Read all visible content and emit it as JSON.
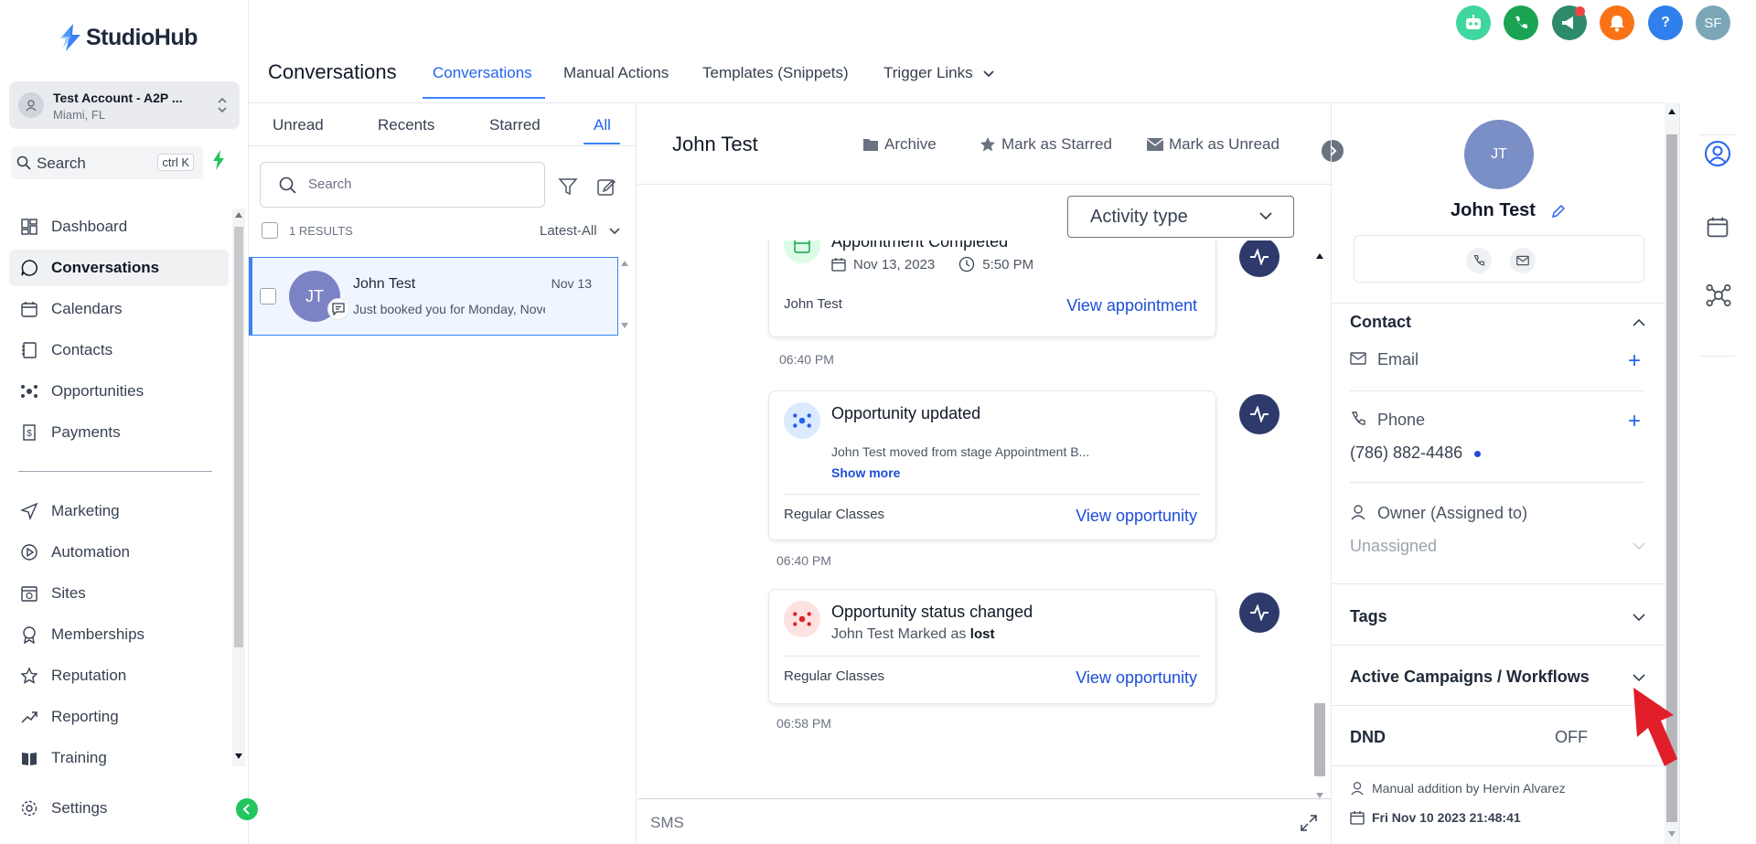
{
  "brand": {
    "name": "StudioHub",
    "accent": "#3b82f6"
  },
  "account": {
    "name": "Test Account - A2P ...",
    "location": "Miami, FL"
  },
  "sidebar": {
    "search_label": "Search",
    "shortcut": "ctrl K",
    "items": [
      {
        "label": "Dashboard",
        "icon": "dashboard-icon"
      },
      {
        "label": "Conversations",
        "icon": "chat-icon",
        "active": true
      },
      {
        "label": "Calendars",
        "icon": "calendar-icon"
      },
      {
        "label": "Contacts",
        "icon": "contacts-icon"
      },
      {
        "label": "Opportunities",
        "icon": "opportunities-icon"
      },
      {
        "label": "Payments",
        "icon": "payments-icon"
      },
      {
        "label": "Marketing",
        "icon": "send-icon"
      },
      {
        "label": "Automation",
        "icon": "automation-icon"
      },
      {
        "label": "Sites",
        "icon": "sites-icon"
      },
      {
        "label": "Memberships",
        "icon": "badge-icon"
      },
      {
        "label": "Reputation",
        "icon": "star-icon"
      },
      {
        "label": "Reporting",
        "icon": "trend-icon"
      },
      {
        "label": "Training",
        "icon": "book-icon"
      }
    ],
    "settings_label": "Settings"
  },
  "header": {
    "title": "Conversations",
    "tabs": [
      "Conversations",
      "Manual Actions",
      "Templates (Snippets)",
      "Trigger Links"
    ],
    "avatar_initials": "SF",
    "help_label": "?"
  },
  "list": {
    "tabs": [
      "Unread",
      "Recents",
      "Starred",
      "All"
    ],
    "search_placeholder": "Search",
    "results": "1 RESULTS",
    "sort": "Latest-All",
    "items": [
      {
        "initials": "JT",
        "name": "John Test",
        "date": "Nov 13",
        "snippet": "Just booked you for Monday, Nove"
      }
    ]
  },
  "thread": {
    "name": "John Test",
    "actions": [
      "Archive",
      "Mark as Starred",
      "Mark as Unread"
    ],
    "activity_type": "Activity type",
    "cards": [
      {
        "title": "Appointment Completed",
        "date": "Nov 13, 2023",
        "time": "5:50 PM",
        "foot_left": "John Test",
        "foot_right": "View appointment"
      },
      {
        "title": "Opportunity updated",
        "desc": "John Test moved from stage Appointment B...",
        "show_more": "Show more",
        "foot_left": "Regular Classes",
        "foot_right": "View opportunity"
      },
      {
        "title": "Opportunity status changed",
        "desc_prefix": "John Test Marked as ",
        "desc_bold": "lost",
        "foot_left": "Regular Classes",
        "foot_right": "View opportunity"
      }
    ],
    "timestamps": [
      "06:40 PM",
      "06:40 PM",
      "06:58 PM"
    ],
    "compose_label": "SMS"
  },
  "panel": {
    "initials": "JT",
    "name": "John Test",
    "contact_head": "Contact",
    "email_label": "Email",
    "phone_label": "Phone",
    "phone_value": "(786) 882-4486",
    "owner_label": "Owner (Assigned to)",
    "owner_value": "Unassigned",
    "tags_head": "Tags",
    "campaigns_head": "Active Campaigns / Workflows",
    "dnd_head": "DND",
    "dnd_value": "OFF",
    "added_by": "Manual addition by Hervin Alvarez",
    "added_date": "Fri Nov 10 2023 21:48:41"
  }
}
